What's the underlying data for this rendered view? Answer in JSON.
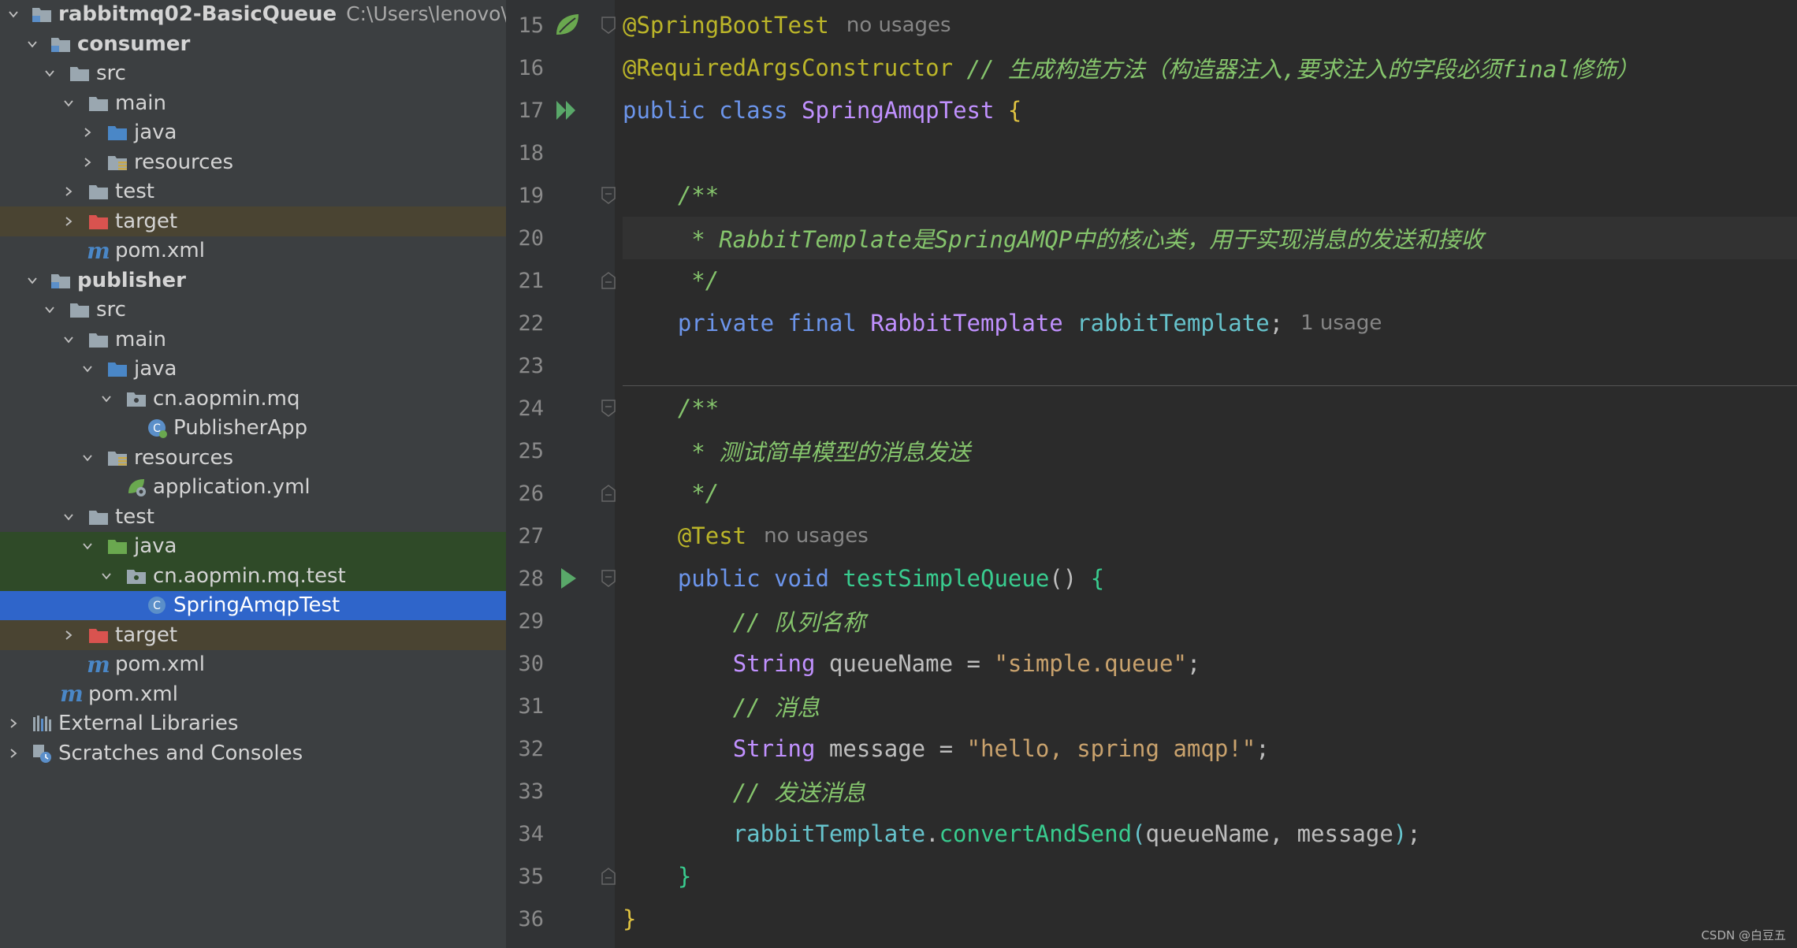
{
  "project_tree": {
    "root": {
      "name": "rabbitmq02-BasicQueue",
      "path": "C:\\Users\\lenovo\\Deskt"
    },
    "rows": [
      {
        "label": "consumer",
        "bold": true
      },
      {
        "label": "src"
      },
      {
        "label": "main"
      },
      {
        "label": "java"
      },
      {
        "label": "resources"
      },
      {
        "label": "test"
      },
      {
        "label": "target"
      },
      {
        "label": "pom.xml"
      },
      {
        "label": "publisher",
        "bold": true
      },
      {
        "label": "src"
      },
      {
        "label": "main"
      },
      {
        "label": "java"
      },
      {
        "label": "cn.aopmin.mq"
      },
      {
        "label": "PublisherApp"
      },
      {
        "label": "resources"
      },
      {
        "label": "application.yml"
      },
      {
        "label": "test"
      },
      {
        "label": "java"
      },
      {
        "label": "cn.aopmin.mq.test"
      },
      {
        "label": "SpringAmqpTest"
      },
      {
        "label": "target"
      },
      {
        "label": "pom.xml"
      },
      {
        "label": "pom.xml"
      },
      {
        "label": "External Libraries"
      },
      {
        "label": "Scratches and Consoles"
      }
    ],
    "icon_m": "m"
  },
  "editor": {
    "line_numbers": [
      "15",
      "16",
      "17",
      "18",
      "19",
      "20",
      "21",
      "22",
      "23",
      "24",
      "25",
      "26",
      "27",
      "28",
      "29",
      "30",
      "31",
      "32",
      "33",
      "34",
      "35",
      "36"
    ],
    "line15": {
      "annotation": "@SpringBootTest",
      "hint": "no usages"
    },
    "line16": {
      "annotation": "@RequiredArgsConstructor",
      "comment": "// 生成构造方法（构造器注入,要求注入的字段必须final修饰）"
    },
    "line17": {
      "kw1": "public",
      "kw2": "class",
      "name": "SpringAmqpTest",
      "brace": "{"
    },
    "line19": {
      "text": "/**"
    },
    "line20": {
      "text": " * RabbitTemplate是SpringAMQP中的核心类，用于实现消息的发送和接收"
    },
    "line21": {
      "text": " */"
    },
    "line22": {
      "kw1": "private",
      "kw2": "final",
      "type": "RabbitTemplate",
      "field": "rabbitTemplate",
      "semi": ";",
      "hint": "1 usage"
    },
    "line24": {
      "text": "/**"
    },
    "line25": {
      "text": " * 测试简单模型的消息发送"
    },
    "line26": {
      "text": " */"
    },
    "line27": {
      "annotation": "@Test",
      "hint": "no usages"
    },
    "line28": {
      "kw1": "public",
      "kw2": "void",
      "method": "testSimpleQueue",
      "parens": "()",
      "brace": "{"
    },
    "line29": {
      "text": "// 队列名称"
    },
    "line30": {
      "type": "String",
      "var": "queueName",
      "eq": "=",
      "value": "\"simple.queue\"",
      "semi": ";"
    },
    "line31": {
      "text": "// 消息"
    },
    "line32": {
      "type": "String",
      "var": "message",
      "eq": "=",
      "value": "\"hello, spring amqp!\"",
      "semi": ";"
    },
    "line33": {
      "text": "// 发送消息"
    },
    "line34": {
      "field": "rabbitTemplate",
      "dot": ".",
      "method": "convertAndSend",
      "lp": "(",
      "arg1": "queueName",
      "comma": ",",
      "arg2": "message",
      "rp": ")",
      "semi": ";"
    },
    "line35": {
      "brace": "}"
    },
    "line36": {
      "brace": "}"
    }
  },
  "watermark": "CSDN @白豆五"
}
